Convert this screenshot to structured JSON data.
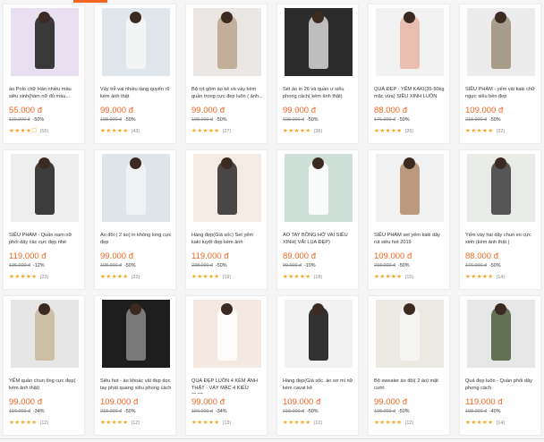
{
  "colors": {
    "accent": "#f26522",
    "star": "#f5a623"
  },
  "products": [
    {
      "title": "áo Polo chữ Hán nhiều màu siêu xinh(hàm nữ đủ màu...",
      "price": "55.000 đ",
      "old": "110.000 đ",
      "discount": "-50%",
      "rating": "★★★★☐",
      "count": "(55)",
      "img": "#e8e0f0",
      "fig": "#1a1a1a"
    },
    {
      "title": "Váy trễ vai nhiều tầng quyến rũ kèm ảnh thật",
      "price": "99.000 đ",
      "old": "198.000 đ",
      "discount": "-50%",
      "rating": "★★★★★",
      "count": "(43)",
      "img": "#dfe6ec",
      "fig": "#f7f7f7"
    },
    {
      "title": "Bộ crt gồm áo kẻ và váy kèm quần trong cực đẹp luôn ( ảnh...",
      "price": "99.000 đ",
      "old": "198.000 đ",
      "discount": "-50%",
      "rating": "★★★★★",
      "count": "(27)",
      "img": "#e9e6e3",
      "fig": "#bba58c"
    },
    {
      "title": "Sét áo in 26 và quần ư siêu phong cách( kèm ảnh thật)",
      "price": "99.000 đ",
      "old": "198.000 đ",
      "discount": "-50%",
      "rating": "★★★★★",
      "count": "(26)",
      "img": "#2b2b2b",
      "fig": "#d8d8d8"
    },
    {
      "title": "QUÁ ĐẸP - YẾM KAKI(35-50kg mặc vừa) SIÊU XINH LUÔN",
      "price": "88.000 đ",
      "old": "176.000 đ",
      "discount": "-50%",
      "rating": "★★★★★",
      "count": "(26)",
      "img": "#f2f2f2",
      "fig": "#e9b4a6"
    },
    {
      "title": "SIÊU PHẨM - yếm vải kaki chữ ngực siêu bền đẹp",
      "price": "109.000 đ",
      "old": "218.000 đ",
      "discount": "-50%",
      "rating": "★★★★★",
      "count": "(22)",
      "img": "#ececec",
      "fig": "#9a8f7a"
    },
    {
      "title": "SIÊU PHẨM - Quần nam nữ phối dây các cực đẹp nhé",
      "price": "119.000 đ",
      "old": "135.000 đ",
      "discount": "-12%",
      "rating": "★★★★★",
      "count": "(23)",
      "img": "#eeeeee",
      "fig": "#1c1c1c"
    },
    {
      "title": "Áo đôi ( 2 áo) in không long cực đẹp",
      "price": "99.000 đ",
      "old": "198.000 đ",
      "discount": "-50%",
      "rating": "★★★★★",
      "count": "(22)",
      "img": "#dfe4e8",
      "fig": "#f3f3f3"
    },
    {
      "title": "Hàng đẹp(Giá sốc) Set yếm kaki tuyệt đẹp kèm ảnh",
      "price": "119.000 đ",
      "old": "238.000 đ",
      "discount": "-50%",
      "rating": "★★★★★",
      "count": "(19)",
      "img": "#f4ece4",
      "fig": "#2a2a2a"
    },
    {
      "title": "ÁO TAY BỒNG HỞ VAI SIÊU XINH( VẢI LỤA ĐẸP)",
      "price": "89.000 đ",
      "old": "99.000 đ",
      "discount": "-10%",
      "rating": "★★★★★",
      "count": "(18)",
      "img": "#cfe0d8",
      "fig": "#ffffff"
    },
    {
      "title": "SIÊU PHẨM set yếm kaki dây rút siêu hot 2019",
      "price": "109.000 đ",
      "old": "218.000 đ",
      "discount": "-50%",
      "rating": "★★★★★",
      "count": "(15)",
      "img": "#f1f1f1",
      "fig": "#b08968"
    },
    {
      "title": "Yếm váy hai dây chun eo cực xinh (kèm ảnh thật )",
      "price": "88.000 đ",
      "old": "176.000 đ",
      "discount": "-50%",
      "rating": "★★★★★",
      "count": "(14)",
      "img": "#e8ebe6",
      "fig": "#3b3b3b"
    },
    {
      "title": "YẾM quần chun ống cực đẹp( kèm ảnh thật)",
      "price": "99.000 đ",
      "old": "150.000 đ",
      "discount": "-34%",
      "rating": "★★★★★",
      "count": "(12)",
      "img": "#e6e6e6",
      "fig": "#c8b69a"
    },
    {
      "title": "Siêu hot - áo khoác vải đẹp dọc tay phát quang siêu phong cách",
      "price": "109.000 đ",
      "old": "218.000 đ",
      "discount": "-50%",
      "rating": "★★★★★",
      "count": "(12)",
      "img": "#1e1e1e",
      "fig": "#8a8a8a"
    },
    {
      "title": "QUÁ ĐẸP LUÔN 4 KÈM ẢNH THẬT - VÁY MẶC 4 KIỂU CỰC...",
      "price": "99.000 đ",
      "old": "150.000 đ",
      "discount": "-34%",
      "rating": "★★★★★",
      "count": "(13)",
      "img": "#f3e9e0",
      "fig": "#ffffff"
    },
    {
      "title": "Hàng đẹp(Giá sốc. áo sơ mi nữ kèm cavat kẻ",
      "price": "109.000 đ",
      "old": "218.000 đ",
      "discount": "-50%",
      "rating": "★★★★★",
      "count": "(12)",
      "img": "#f2f2f2",
      "fig": "#111111"
    },
    {
      "title": "Bộ sweater áo đôi( 2 áo) mặt cười",
      "price": "99.000 đ",
      "old": "198.000 đ",
      "discount": "-50%",
      "rating": "★★★★★",
      "count": "(12)",
      "img": "#ece8e2",
      "fig": "#f7f7f7"
    },
    {
      "title": "Quá đẹp luôn - Quần phối dây phong cách",
      "price": "119.000 đ",
      "old": "198.000 đ",
      "discount": "-40%",
      "rating": "★★★★★",
      "count": "(14)",
      "img": "#e7e7e7",
      "fig": "#4a5a3a"
    }
  ]
}
